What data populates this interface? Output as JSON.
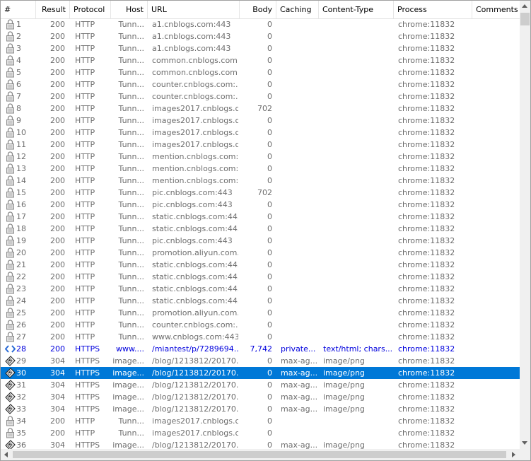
{
  "columns": {
    "num": "#",
    "result": "Result",
    "protocol": "Protocol",
    "host": "Host",
    "url": "URL",
    "body": "Body",
    "caching": "Caching",
    "content_type": "Content-Type",
    "process": "Process",
    "comments": "Comments"
  },
  "icons": {
    "tunnel": "lock-icon",
    "html": "html-document-icon",
    "image": "image-file-icon"
  },
  "colors": {
    "selected_bg": "#0078d7",
    "https_text": "#0000dd",
    "normal_text": "#6d6d6d"
  },
  "sessions": [
    {
      "num": "1",
      "result": "200",
      "protocol": "HTTP",
      "host": "Tunn...",
      "url": "a1.cnblogs.com:443",
      "body": "0",
      "caching": "",
      "content_type": "",
      "process": "chrome:11832",
      "comments": "",
      "icon": "tunnel"
    },
    {
      "num": "2",
      "result": "200",
      "protocol": "HTTP",
      "host": "Tunn...",
      "url": "a1.cnblogs.com:443",
      "body": "0",
      "caching": "",
      "content_type": "",
      "process": "chrome:11832",
      "comments": "",
      "icon": "tunnel"
    },
    {
      "num": "3",
      "result": "200",
      "protocol": "HTTP",
      "host": "Tunn...",
      "url": "a1.cnblogs.com:443",
      "body": "0",
      "caching": "",
      "content_type": "",
      "process": "chrome:11832",
      "comments": "",
      "icon": "tunnel"
    },
    {
      "num": "4",
      "result": "200",
      "protocol": "HTTP",
      "host": "Tunn...",
      "url": "common.cnblogs.com:...",
      "body": "0",
      "caching": "",
      "content_type": "",
      "process": "chrome:11832",
      "comments": "",
      "icon": "tunnel"
    },
    {
      "num": "5",
      "result": "200",
      "protocol": "HTTP",
      "host": "Tunn...",
      "url": "common.cnblogs.com:...",
      "body": "0",
      "caching": "",
      "content_type": "",
      "process": "chrome:11832",
      "comments": "",
      "icon": "tunnel"
    },
    {
      "num": "6",
      "result": "200",
      "protocol": "HTTP",
      "host": "Tunn...",
      "url": "counter.cnblogs.com:...",
      "body": "0",
      "caching": "",
      "content_type": "",
      "process": "chrome:11832",
      "comments": "",
      "icon": "tunnel"
    },
    {
      "num": "7",
      "result": "200",
      "protocol": "HTTP",
      "host": "Tunn...",
      "url": "counter.cnblogs.com:...",
      "body": "0",
      "caching": "",
      "content_type": "",
      "process": "chrome:11832",
      "comments": "",
      "icon": "tunnel"
    },
    {
      "num": "8",
      "result": "200",
      "protocol": "HTTP",
      "host": "Tunn...",
      "url": "images2017.cnblogs.c...",
      "body": "702",
      "caching": "",
      "content_type": "",
      "process": "chrome:11832",
      "comments": "",
      "icon": "tunnel"
    },
    {
      "num": "9",
      "result": "200",
      "protocol": "HTTP",
      "host": "Tunn...",
      "url": "images2017.cnblogs.c...",
      "body": "0",
      "caching": "",
      "content_type": "",
      "process": "chrome:11832",
      "comments": "",
      "icon": "tunnel"
    },
    {
      "num": "10",
      "result": "200",
      "protocol": "HTTP",
      "host": "Tunn...",
      "url": "images2017.cnblogs.c...",
      "body": "0",
      "caching": "",
      "content_type": "",
      "process": "chrome:11832",
      "comments": "",
      "icon": "tunnel"
    },
    {
      "num": "11",
      "result": "200",
      "protocol": "HTTP",
      "host": "Tunn...",
      "url": "images2017.cnblogs.c...",
      "body": "0",
      "caching": "",
      "content_type": "",
      "process": "chrome:11832",
      "comments": "",
      "icon": "tunnel"
    },
    {
      "num": "12",
      "result": "200",
      "protocol": "HTTP",
      "host": "Tunn...",
      "url": "mention.cnblogs.com:...",
      "body": "0",
      "caching": "",
      "content_type": "",
      "process": "chrome:11832",
      "comments": "",
      "icon": "tunnel"
    },
    {
      "num": "13",
      "result": "200",
      "protocol": "HTTP",
      "host": "Tunn...",
      "url": "mention.cnblogs.com:...",
      "body": "0",
      "caching": "",
      "content_type": "",
      "process": "chrome:11832",
      "comments": "",
      "icon": "tunnel"
    },
    {
      "num": "14",
      "result": "200",
      "protocol": "HTTP",
      "host": "Tunn...",
      "url": "mention.cnblogs.com:...",
      "body": "0",
      "caching": "",
      "content_type": "",
      "process": "chrome:11832",
      "comments": "",
      "icon": "tunnel"
    },
    {
      "num": "15",
      "result": "200",
      "protocol": "HTTP",
      "host": "Tunn...",
      "url": "pic.cnblogs.com:443",
      "body": "702",
      "caching": "",
      "content_type": "",
      "process": "chrome:11832",
      "comments": "",
      "icon": "tunnel"
    },
    {
      "num": "16",
      "result": "200",
      "protocol": "HTTP",
      "host": "Tunn...",
      "url": "pic.cnblogs.com:443",
      "body": "0",
      "caching": "",
      "content_type": "",
      "process": "chrome:11832",
      "comments": "",
      "icon": "tunnel"
    },
    {
      "num": "17",
      "result": "200",
      "protocol": "HTTP",
      "host": "Tunn...",
      "url": "static.cnblogs.com:443",
      "body": "0",
      "caching": "",
      "content_type": "",
      "process": "chrome:11832",
      "comments": "",
      "icon": "tunnel"
    },
    {
      "num": "18",
      "result": "200",
      "protocol": "HTTP",
      "host": "Tunn...",
      "url": "static.cnblogs.com:443",
      "body": "0",
      "caching": "",
      "content_type": "",
      "process": "chrome:11832",
      "comments": "",
      "icon": "tunnel"
    },
    {
      "num": "19",
      "result": "200",
      "protocol": "HTTP",
      "host": "Tunn...",
      "url": "pic.cnblogs.com:443",
      "body": "0",
      "caching": "",
      "content_type": "",
      "process": "chrome:11832",
      "comments": "",
      "icon": "tunnel"
    },
    {
      "num": "20",
      "result": "200",
      "protocol": "HTTP",
      "host": "Tunn...",
      "url": "promotion.aliyun.com...",
      "body": "0",
      "caching": "",
      "content_type": "",
      "process": "chrome:11832",
      "comments": "",
      "icon": "tunnel"
    },
    {
      "num": "21",
      "result": "200",
      "protocol": "HTTP",
      "host": "Tunn...",
      "url": "static.cnblogs.com:443",
      "body": "0",
      "caching": "",
      "content_type": "",
      "process": "chrome:11832",
      "comments": "",
      "icon": "tunnel"
    },
    {
      "num": "22",
      "result": "200",
      "protocol": "HTTP",
      "host": "Tunn...",
      "url": "static.cnblogs.com:443",
      "body": "0",
      "caching": "",
      "content_type": "",
      "process": "chrome:11832",
      "comments": "",
      "icon": "tunnel"
    },
    {
      "num": "23",
      "result": "200",
      "protocol": "HTTP",
      "host": "Tunn...",
      "url": "static.cnblogs.com:443",
      "body": "0",
      "caching": "",
      "content_type": "",
      "process": "chrome:11832",
      "comments": "",
      "icon": "tunnel"
    },
    {
      "num": "24",
      "result": "200",
      "protocol": "HTTP",
      "host": "Tunn...",
      "url": "static.cnblogs.com:443",
      "body": "0",
      "caching": "",
      "content_type": "",
      "process": "chrome:11832",
      "comments": "",
      "icon": "tunnel"
    },
    {
      "num": "25",
      "result": "200",
      "protocol": "HTTP",
      "host": "Tunn...",
      "url": "promotion.aliyun.com...",
      "body": "0",
      "caching": "",
      "content_type": "",
      "process": "chrome:11832",
      "comments": "",
      "icon": "tunnel"
    },
    {
      "num": "26",
      "result": "200",
      "protocol": "HTTP",
      "host": "Tunn...",
      "url": "counter.cnblogs.com:...",
      "body": "0",
      "caching": "",
      "content_type": "",
      "process": "chrome:11832",
      "comments": "",
      "icon": "tunnel"
    },
    {
      "num": "27",
      "result": "200",
      "protocol": "HTTP",
      "host": "Tunn...",
      "url": "www.cnblogs.com:443",
      "body": "0",
      "caching": "",
      "content_type": "",
      "process": "chrome:11832",
      "comments": "",
      "icon": "tunnel"
    },
    {
      "num": "28",
      "result": "200",
      "protocol": "HTTPS",
      "host": "www....",
      "url": "/miantest/p/7289694....",
      "body": "7,742",
      "caching": "private...",
      "content_type": "text/html; chars...",
      "process": "chrome:11832",
      "comments": "",
      "icon": "html",
      "style": "https"
    },
    {
      "num": "29",
      "result": "304",
      "protocol": "HTTPS",
      "host": "image...",
      "url": "/blog/1213812/20170...",
      "body": "0",
      "caching": "max-ag...",
      "content_type": "image/png",
      "process": "chrome:11832",
      "comments": "",
      "icon": "image"
    },
    {
      "num": "30",
      "result": "304",
      "protocol": "HTTPS",
      "host": "image...",
      "url": "/blog/1213812/20170...",
      "body": "0",
      "caching": "max-ag...",
      "content_type": "image/png",
      "process": "chrome:11832",
      "comments": "",
      "icon": "image",
      "style": "sel"
    },
    {
      "num": "31",
      "result": "304",
      "protocol": "HTTPS",
      "host": "image...",
      "url": "/blog/1213812/20170...",
      "body": "0",
      "caching": "max-ag...",
      "content_type": "image/png",
      "process": "chrome:11832",
      "comments": "",
      "icon": "image"
    },
    {
      "num": "32",
      "result": "304",
      "protocol": "HTTPS",
      "host": "image...",
      "url": "/blog/1213812/20170...",
      "body": "0",
      "caching": "max-ag...",
      "content_type": "image/png",
      "process": "chrome:11832",
      "comments": "",
      "icon": "image"
    },
    {
      "num": "33",
      "result": "304",
      "protocol": "HTTPS",
      "host": "image...",
      "url": "/blog/1213812/20170...",
      "body": "0",
      "caching": "max-ag...",
      "content_type": "image/png",
      "process": "chrome:11832",
      "comments": "",
      "icon": "image"
    },
    {
      "num": "34",
      "result": "200",
      "protocol": "HTTP",
      "host": "Tunn...",
      "url": "images2017.cnblogs.c...",
      "body": "0",
      "caching": "",
      "content_type": "",
      "process": "chrome:11832",
      "comments": "",
      "icon": "tunnel"
    },
    {
      "num": "35",
      "result": "200",
      "protocol": "HTTP",
      "host": "Tunn...",
      "url": "images2017.cnblogs.c...",
      "body": "0",
      "caching": "",
      "content_type": "",
      "process": "chrome:11832",
      "comments": "",
      "icon": "tunnel"
    },
    {
      "num": "36",
      "result": "304",
      "protocol": "HTTPS",
      "host": "image...",
      "url": "/blog/1213812/20170...",
      "body": "0",
      "caching": "max-ag...",
      "content_type": "image/png",
      "process": "chrome:11832",
      "comments": "",
      "icon": "image"
    }
  ]
}
